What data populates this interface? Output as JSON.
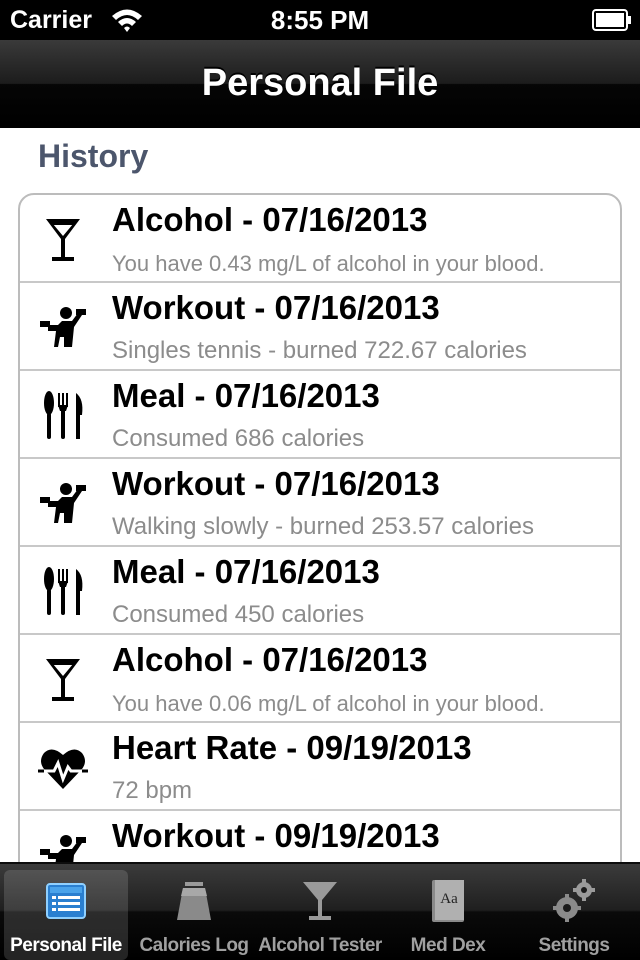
{
  "status_bar": {
    "carrier": "Carrier",
    "time": "8:55 PM",
    "wifi_icon": "wifi-icon",
    "battery_icon": "battery-icon"
  },
  "nav_bar": {
    "title": "Personal File"
  },
  "history": {
    "section_title": "History",
    "rows": [
      {
        "icon": "cocktail-icon",
        "title": "Alcohol - 07/16/2013",
        "subtitle": "You have 0.43 mg/L of alcohol in your blood."
      },
      {
        "icon": "workout-icon",
        "title": "Workout - 07/16/2013",
        "subtitle": "Singles tennis - burned 722.67 calories"
      },
      {
        "icon": "utensils-icon",
        "title": "Meal - 07/16/2013",
        "subtitle": "Consumed 686 calories"
      },
      {
        "icon": "workout-icon",
        "title": "Workout - 07/16/2013",
        "subtitle": "Walking slowly - burned 253.57 calories"
      },
      {
        "icon": "utensils-icon",
        "title": "Meal - 07/16/2013",
        "subtitle": "Consumed 450 calories"
      },
      {
        "icon": "cocktail-icon",
        "title": "Alcohol - 07/16/2013",
        "subtitle": "You have 0.06 mg/L of alcohol in your blood."
      },
      {
        "icon": "heart-rate-icon",
        "title": "Heart Rate - 09/19/2013",
        "subtitle": "72 bpm"
      },
      {
        "icon": "workout-icon",
        "title": "Workout - 09/19/2013",
        "subtitle": ""
      }
    ]
  },
  "tab_bar": {
    "tabs": [
      {
        "label": "Personal File",
        "icon": "personal-file-icon",
        "active": true
      },
      {
        "label": "Calories Log",
        "icon": "scale-icon",
        "active": false
      },
      {
        "label": "Alcohol Tester",
        "icon": "cocktail-glass-icon",
        "active": false
      },
      {
        "label": "Med Dex",
        "icon": "book-icon",
        "active": false
      },
      {
        "label": "Settings",
        "icon": "gears-icon",
        "active": false
      }
    ]
  },
  "colors": {
    "section_header": "#4c566c",
    "subtitle": "#8c8c8c",
    "tab_active_label": "#ffffff",
    "tab_inactive_label": "#a0a0a0",
    "tab_active_icon": "#4aa3ea"
  }
}
